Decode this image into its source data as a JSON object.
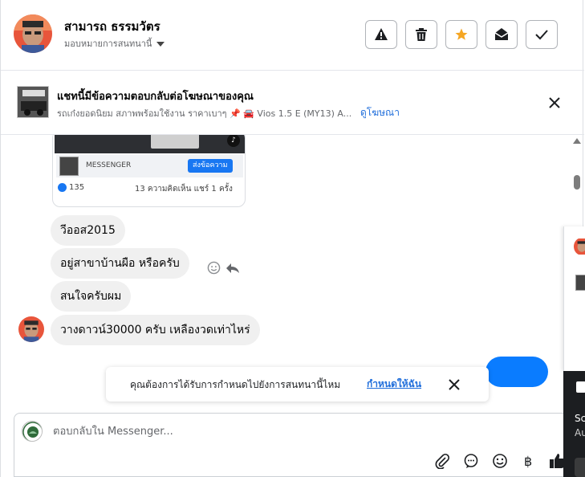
{
  "header": {
    "contact_name": "สามารถ ธรรมวัตร",
    "assign_label": "มอบหมายการสนทนานี้",
    "actions": [
      {
        "name": "report-spam-button",
        "icon": "warning-icon"
      },
      {
        "name": "delete-button",
        "icon": "trash-icon"
      },
      {
        "name": "star-button",
        "icon": "star-icon"
      },
      {
        "name": "mark-unread-button",
        "icon": "envelope-open-icon"
      },
      {
        "name": "mark-done-button",
        "icon": "check-icon"
      }
    ],
    "accent_star_color": "#f5a623"
  },
  "ad": {
    "title": "แชทนี้มีข้อความตอบกลับต่อโฆษณาของคุณ",
    "subtitle": "รถเก๋งยอดนิยม สภาพพร้อมใช้งาน ราคาเบาๆ 📌 🚘 Vios 1.5 E (MY13) A...",
    "link": "ดูโฆษณา"
  },
  "post": {
    "messenger_label": "MESSENGER",
    "send_label": "ส่งข้อความ",
    "likes": "135",
    "comments": "13 ความคิดเห็น",
    "shares": "แชร์ 1 ครั้ง"
  },
  "messages": [
    {
      "text": "วีออส2015"
    },
    {
      "text": "อยู่สาขาบ้านผือ หรือครับ"
    },
    {
      "text": "สนใจครับผม"
    },
    {
      "text": "วางดาวน์30000 ครับ  เหลืองวดเท่าไหร่"
    }
  ],
  "toast": {
    "text": "คุณต้องการได้รับการกำหนดไปยังการสนทนานี้ไหม",
    "link": "กำหนดให้ฉัน"
  },
  "composer": {
    "placeholder": "ตอบกลับใน Messenger...",
    "tools": [
      "paperclip-icon",
      "saved-reply-icon",
      "emoji-icon",
      "baht-icon",
      "thumbs-up-icon"
    ]
  },
  "side_panel": {
    "title_partial": "Sc",
    "sub_partial": "Au"
  },
  "colors": {
    "link_blue": "#216fdb",
    "outgoing_bubble": "#0a7cff",
    "incoming_bubble": "#f0f0f0"
  }
}
